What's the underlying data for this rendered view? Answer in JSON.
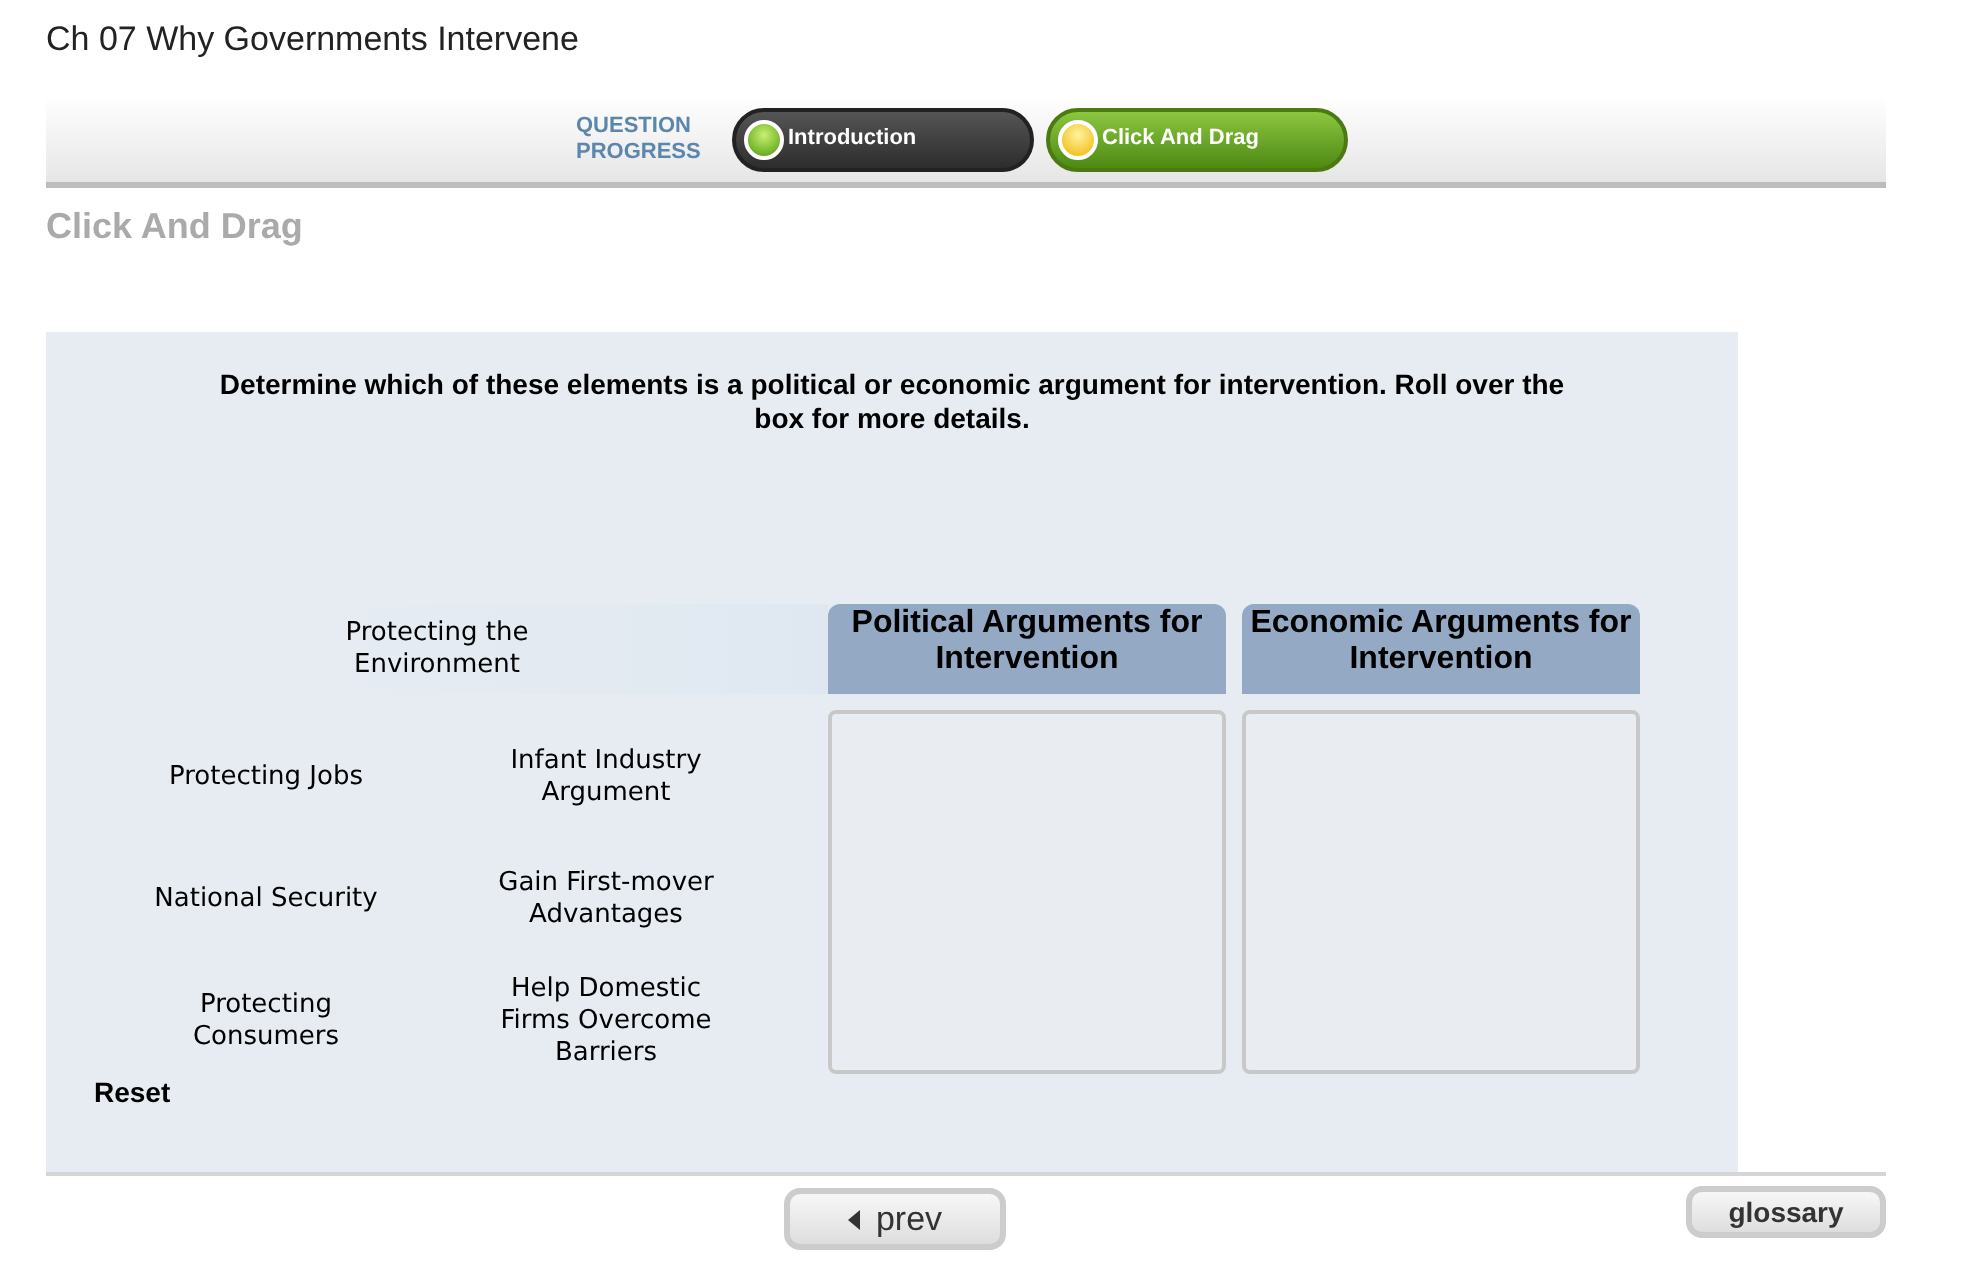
{
  "page_title": "Ch 07 Why Governments Intervene",
  "progress": {
    "label": "QUESTION PROGRESS",
    "steps": [
      {
        "label": "Introduction",
        "selected": false
      },
      {
        "label": "Click And Drag",
        "selected": true
      }
    ]
  },
  "section_title": "Click And Drag",
  "instructions": "Determine which of these elements is a political or economic argument for intervention. Roll over the box for more details.",
  "dragging_item": {
    "label": "Protecting the Environment"
  },
  "items": [
    {
      "label": "Protecting Jobs"
    },
    {
      "label": "National Security"
    },
    {
      "label": "Protecting Consumers"
    },
    {
      "label": "Infant Industry Argument"
    },
    {
      "label": "Gain First-mover Advantages"
    },
    {
      "label": "Help Domestic Firms Overcome Barriers"
    }
  ],
  "targets": [
    {
      "heading": "Political Arguments for Intervention"
    },
    {
      "heading": "Economic Arguments for Intervention"
    }
  ],
  "reset": "Reset",
  "nav": {
    "prev": "prev",
    "glossary": "glossary"
  }
}
